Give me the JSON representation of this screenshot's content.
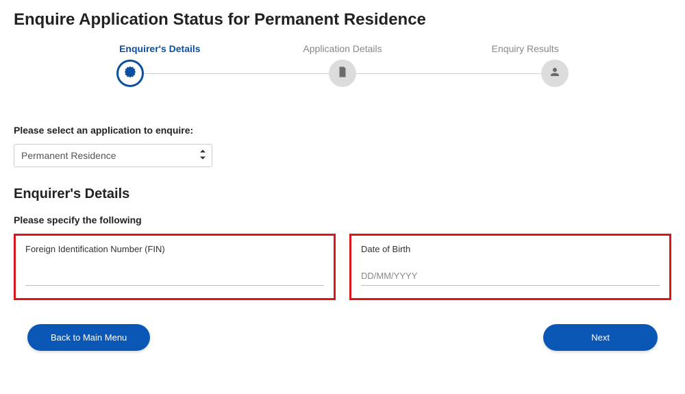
{
  "title": "Enquire Application Status for Permanent Residence",
  "steps": {
    "s1": "Enquirer's Details",
    "s2": "Application Details",
    "s3": "Enquiry Results"
  },
  "prompt_select": "Please select an application to enquire:",
  "application_select": {
    "selected": "Permanent Residence"
  },
  "section_heading": "Enquirer's Details",
  "prompt_specify": "Please specify the following",
  "fields": {
    "fin": {
      "label": "Foreign Identification Number (FIN)",
      "value": ""
    },
    "dob": {
      "label": "Date of Birth",
      "placeholder": "DD/MM/YYYY",
      "value": ""
    }
  },
  "buttons": {
    "back": "Back to Main Menu",
    "next": "Next"
  }
}
